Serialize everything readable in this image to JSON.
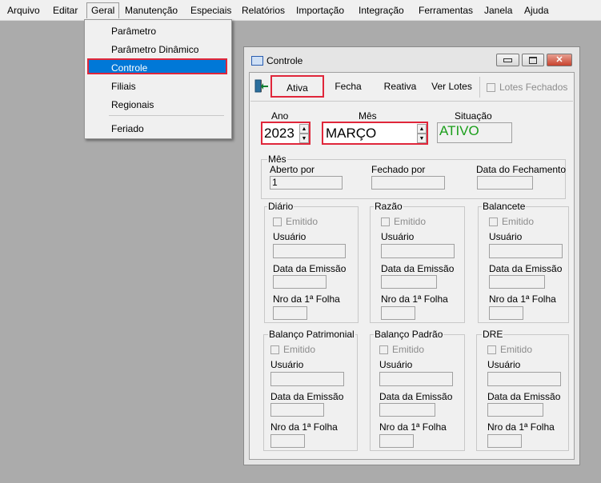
{
  "menubar": {
    "items": [
      "Arquivo",
      "Editar",
      "Geral",
      "Manutenção",
      "Especiais",
      "Relatórios",
      "Importação",
      "Integração",
      "Ferramentas",
      "Janela",
      "Ajuda"
    ]
  },
  "geral_menu": {
    "items": [
      "Parâmetro",
      "Parâmetro Dinâmico",
      "Controle",
      "Filiais",
      "Regionais",
      "Feriado"
    ],
    "highlighted": "Controle"
  },
  "window": {
    "title": "Controle",
    "toolbar": {
      "ativa": "Ativa",
      "fecha": "Fecha",
      "reativa": "Reativa",
      "ver_lotes": "Ver Lotes",
      "lotes_fechados": "Lotes Fechados"
    },
    "ano": {
      "label": "Ano",
      "value": "2023"
    },
    "mes": {
      "label": "Mês",
      "value": "MARÇO"
    },
    "situacao": {
      "label": "Situação",
      "value": "ATIVO",
      "color": "#1a9e1a"
    },
    "mes_group": {
      "title": "Mês",
      "aberto_por_label": "Aberto por",
      "aberto_por_value": "1",
      "fechado_por_label": "Fechado por",
      "data_fechamento_label": "Data do Fechamento"
    },
    "books": {
      "diario": "Diário",
      "razao": "Razão",
      "balancete": "Balancete",
      "balanco_patrimonial": "Balanço Patrimonial",
      "balanco_padrao": "Balanço Padrão",
      "dre": "DRE"
    },
    "common": {
      "emitido": "Emitido",
      "usuario": "Usuário",
      "data_emissao": "Data da Emissão",
      "nro_folha": "Nro da 1ª Folha"
    }
  },
  "colors": {
    "highlight": "#0078d7",
    "annotation_red": "#e0263a",
    "desktop": "#ababab"
  }
}
